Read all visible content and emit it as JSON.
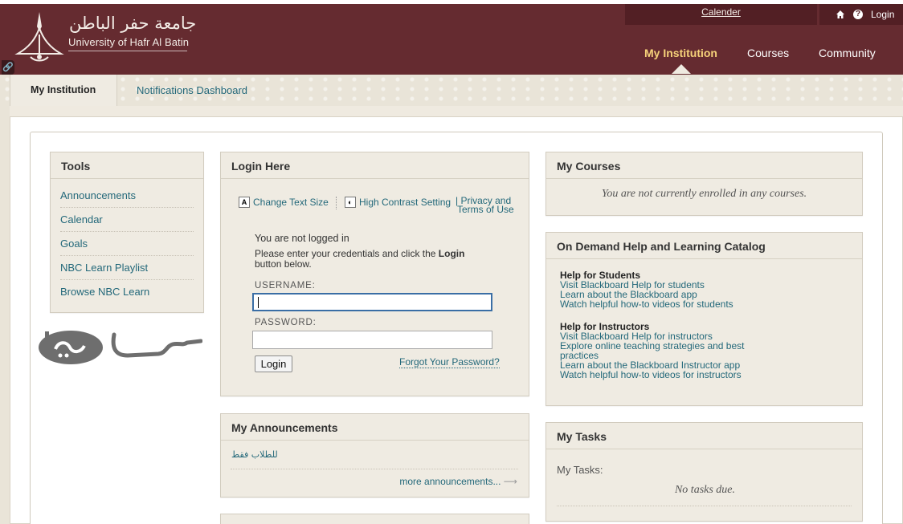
{
  "header": {
    "logo_arabic": "جامعة حفر الباطن",
    "logo_english": "University of Hafr Al Batin",
    "calender_link": "Calender",
    "login_label": "Login",
    "nav": [
      {
        "label": "My Institution",
        "active": true
      },
      {
        "label": "Courses",
        "active": false
      },
      {
        "label": "Community",
        "active": false
      }
    ]
  },
  "subnav": {
    "items": [
      {
        "label": "My Institution",
        "active": true
      },
      {
        "label": "Notifications Dashboard",
        "active": false
      }
    ]
  },
  "tools": {
    "title": "Tools",
    "items": [
      "Announcements",
      "Calendar",
      "Goals",
      "NBC Learn Playlist",
      "Browse NBC Learn"
    ]
  },
  "login": {
    "title": "Login Here",
    "change_text_size": "Change Text Size",
    "high_contrast": "High Contrast Setting",
    "privacy": "Privacy and",
    "terms": "Terms of Use",
    "not_logged_in": "You are not logged in",
    "instructions_pre": "Please enter your credentials and click the ",
    "instructions_bold": "Login",
    "instructions_post": "button below.",
    "username_label": "USERNAME:",
    "username_value": "",
    "password_label": "PASSWORD:",
    "password_value": "",
    "login_button": "Login",
    "forgot_link": "Forgot Your Password?"
  },
  "my_courses": {
    "title": "My Courses",
    "empty_note": "You are not currently enrolled in any courses."
  },
  "help_catalog": {
    "title": "On Demand Help and Learning Catalog",
    "students_heading": "Help for Students",
    "students_links": [
      "Visit Blackboard Help for students",
      "Learn about the Blackboard app",
      "Watch helpful how-to videos for students"
    ],
    "instructors_heading": "Help for Instructors",
    "instructors_links": [
      "Visit Blackboard Help for instructors",
      "Explore online teaching strategies and best practices",
      "Learn about the Blackboard Instructor app",
      "Watch helpful how-to videos for instructors"
    ]
  },
  "announcements": {
    "title": "My Announcements",
    "item": "للطلاب فقط",
    "more": "more announcements...",
    "more_arrow": "⟶"
  },
  "tasks": {
    "title": "My Tasks",
    "label": "My Tasks:",
    "empty_note": "No tasks due."
  },
  "colors": {
    "brand": "#652b30",
    "brand_dark": "#521f24",
    "active_nav": "#f6d27a",
    "link": "#23687a",
    "module_bg": "#efebe2"
  }
}
